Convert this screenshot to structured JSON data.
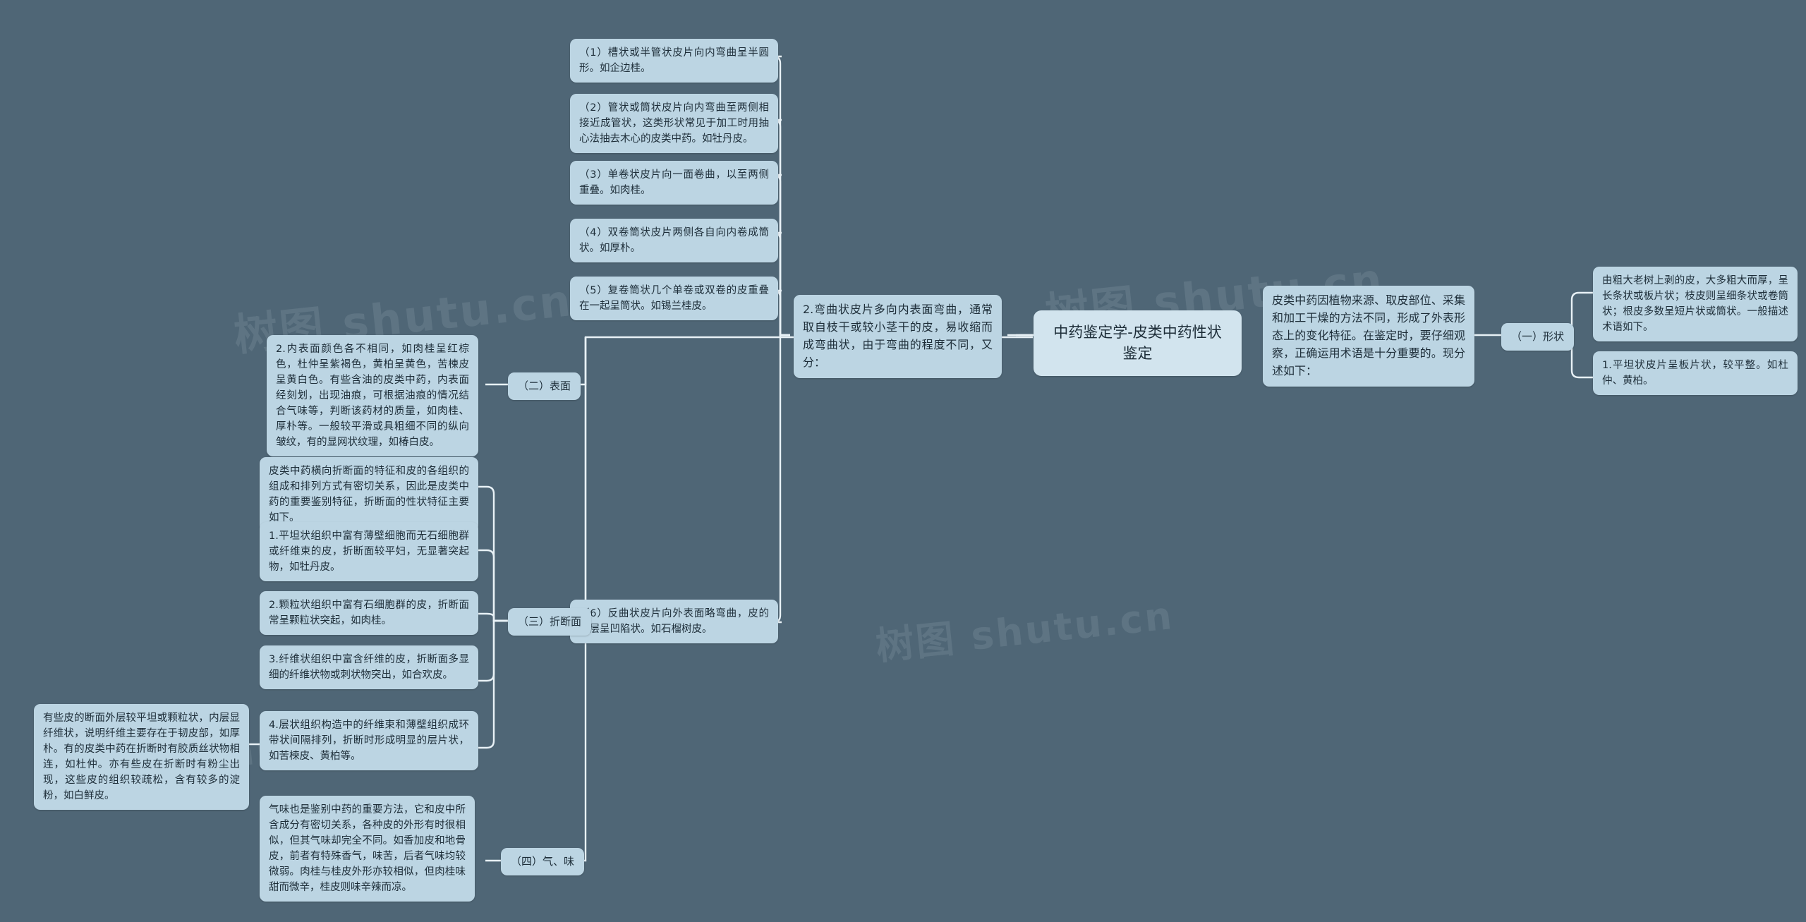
{
  "meta": {
    "watermark": "树图 shutu.cn",
    "bg_color": "#4f6676",
    "node_color": "#bcd5e3",
    "center_color": "#d2e4ee",
    "line_color": "#e8f1f6"
  },
  "center": {
    "title": "中药鉴定学-皮类中药性状鉴定"
  },
  "intro": {
    "text": "皮类中药因植物来源、取皮部位、采集和加工干燥的方法不同，形成了外表形态上的变化特征。在鉴定时，要仔细观察，正确运用术语是十分重要的。现分述如下："
  },
  "branches": [
    {
      "label": "（一）形状",
      "lead": "由粗大老树上剥的皮，大多粗大而厚，呈长条状或板片状；枝皮则呈细条状或卷筒状；根皮多数呈短片状或筒状。一般描述术语如下。",
      "items": [
        "1.平坦状皮片呈板片状，较平整。如杜仲、黄柏。",
        "2.弯曲状皮片多向内表面弯曲，通常取自枝干或较小茎干的皮，易收缩而成弯曲状，由于弯曲的程度不同，又分："
      ],
      "sub_items": [
        "（1）槽状或半管状皮片向内弯曲呈半圆形。如企边桂。",
        "（2）管状或筒状皮片向内弯曲至两侧相接近成管状，这类形状常见于加工时用抽心法抽去木心的皮类中药。如牡丹皮。",
        "（3）单卷状皮片向一面卷曲，以至两侧重叠。如肉桂。",
        "（4）双卷筒状皮片两侧各自向内卷成筒状。如厚朴。",
        "（5）复卷筒状几个单卷或双卷的皮重叠在一起呈筒状。如锡兰桂皮。",
        "（6）反曲状皮片向外表面略弯曲，皮的外层呈凹陷状。如石榴树皮。"
      ]
    },
    {
      "label": "（二）表面",
      "items": [
        "2.内表面颜色各不相同，如肉桂呈红棕色，杜仲呈紫褐色，黄柏呈黄色，苦楝皮呈黄白色。有些含油的皮类中药，内表面经刻划，出现油痕，可根据油痕的情况结合气味等，判断该药材的质量，如肉桂、厚朴等。一般较平滑或具粗细不同的纵向皱纹，有的显网状纹理，如椿白皮。"
      ]
    },
    {
      "label": "（三）折断面",
      "lead": "皮类中药横向折断面的特征和皮的各组织的组成和排列方式有密切关系，因此是皮类中药的重要鉴别特征，折断面的性状特征主要如下。",
      "items": [
        "1.平坦状组织中富有薄壁细胞而无石细胞群或纤维束的皮，折断面较平妇，无显著突起物，如牡丹皮。",
        "2.颗粒状组织中富有石细胞群的皮，折断面常呈颗粒状突起，如肉桂。",
        "3.纤维状组织中富含纤维的皮，折断面多显细的纤维状物或刺状物突出，如合欢皮。",
        "4.层状组织构造中的纤维束和薄壁组织成环带状间隔排列，折断时形成明显的层片状，如苦楝皮、黄柏等。"
      ],
      "tail": "有些皮的断面外层较平坦或颗粒状，内层显纤维状，说明纤维主要存在于韧皮部，如厚朴。有的皮类中药在折断时有胶质丝状物相连，如杜仲。亦有些皮在折断时有粉尘出现，这些皮的组织较疏松，含有较多的淀粉，如白鲜皮。"
    },
    {
      "label": "（四）气、味",
      "items": [
        "气味也是鉴别中药的重要方法，它和皮中所含成分有密切关系，各种皮的外形有时很相似，但其气味却完全不同。如香加皮和地骨皮，前者有特殊香气，味苦，后者气味均较微弱。肉桂与桂皮外形亦较相似，但肉桂味甜而微辛，桂皮则味辛辣而凉。"
      ]
    }
  ]
}
